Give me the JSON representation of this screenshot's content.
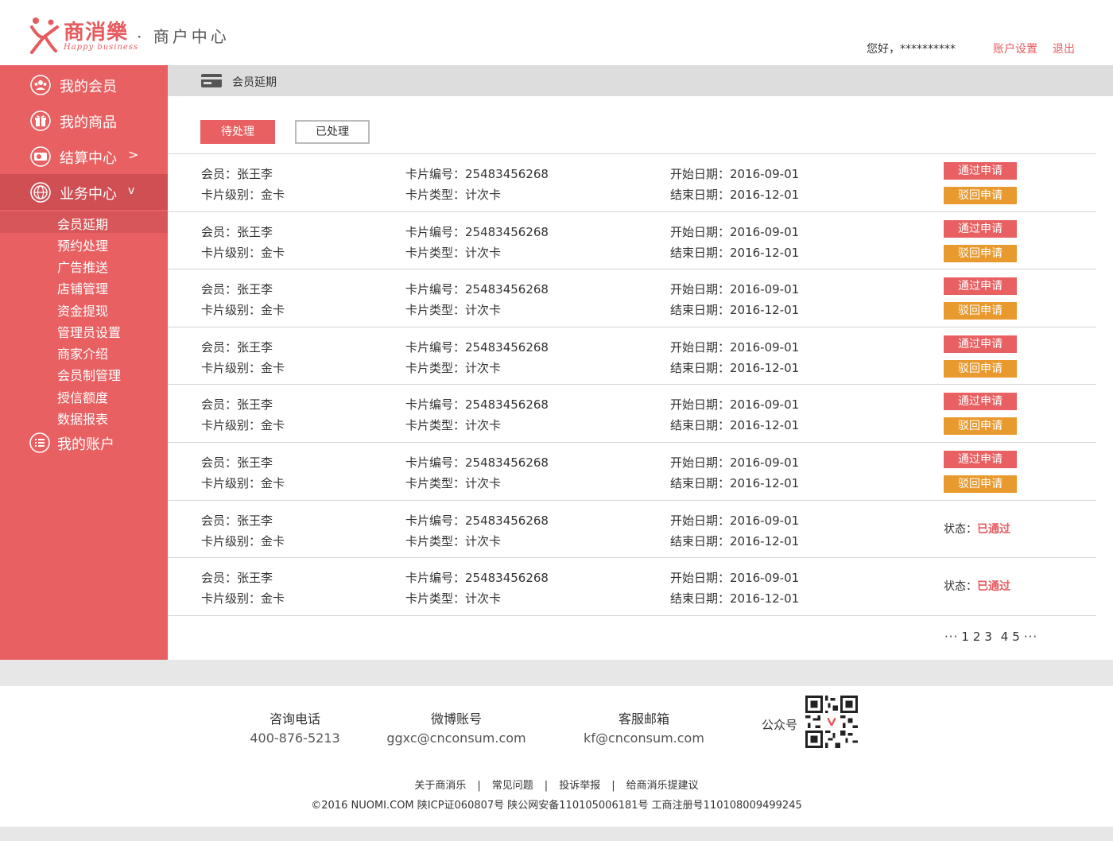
{
  "brand": {
    "logo_cn": "商消樂",
    "logo_en": "Happy business",
    "portal_title": "· 商户中心"
  },
  "header": {
    "greeting": "您好，**********",
    "account_settings": "账户设置",
    "logout": "退出"
  },
  "sidebar": {
    "items": [
      {
        "label": "我的会员",
        "icon": "members-icon"
      },
      {
        "label": "我的商品",
        "icon": "gift-icon"
      },
      {
        "label": "结算中心",
        "arrow": ">",
        "icon": "settlement-icon"
      },
      {
        "label": "业务中心",
        "arrow": "v",
        "icon": "globe-icon"
      }
    ],
    "sub_items": [
      "会员延期",
      "预约处理",
      "广告推送",
      "店铺管理",
      "资金提现",
      "管理员设置",
      "商家介绍",
      "会员制管理",
      "授信额度",
      "数据报表"
    ],
    "account": {
      "label": "我的账户",
      "icon": "list-icon"
    }
  },
  "breadcrumb": {
    "label": "会员延期",
    "icon": "card-icon"
  },
  "tabs": {
    "pending": "待处理",
    "done": "已处理"
  },
  "rows": [
    {
      "member": "会员：张王李",
      "level": "卡片级别：金卡",
      "card_no": "卡片编号：25483456268",
      "card_type": "卡片类型：计次卡",
      "start": "开始日期：2016-09-01",
      "end": "结束日期：2016-12-01",
      "pass": "通过申请",
      "reject": "驳回申请"
    },
    {
      "member": "会员：张王李",
      "level": "卡片级别：金卡",
      "card_no": "卡片编号：25483456268",
      "card_type": "卡片类型：计次卡",
      "start": "开始日期：2016-09-01",
      "end": "结束日期：2016-12-01",
      "pass": "通过申请",
      "reject": "驳回申请"
    },
    {
      "member": "会员：张王李",
      "level": "卡片级别：金卡",
      "card_no": "卡片编号：25483456268",
      "card_type": "卡片类型：计次卡",
      "start": "开始日期：2016-09-01",
      "end": "结束日期：2016-12-01",
      "pass": "通过申请",
      "reject": "驳回申请"
    },
    {
      "member": "会员：张王李",
      "level": "卡片级别：金卡",
      "card_no": "卡片编号：25483456268",
      "card_type": "卡片类型：计次卡",
      "start": "开始日期：2016-09-01",
      "end": "结束日期：2016-12-01",
      "pass": "通过申请",
      "reject": "驳回申请"
    },
    {
      "member": "会员：张王李",
      "level": "卡片级别：金卡",
      "card_no": "卡片编号：25483456268",
      "card_type": "卡片类型：计次卡",
      "start": "开始日期：2016-09-01",
      "end": "结束日期：2016-12-01",
      "pass": "通过申请",
      "reject": "驳回申请"
    },
    {
      "member": "会员：张王李",
      "level": "卡片级别：金卡",
      "card_no": "卡片编号：25483456268",
      "card_type": "卡片类型：计次卡",
      "start": "开始日期：2016-09-01",
      "end": "结束日期：2016-12-01",
      "pass": "通过申请",
      "reject": "驳回申请"
    },
    {
      "member": "会员：张王李",
      "level": "卡片级别：金卡",
      "card_no": "卡片编号：25483456268",
      "card_type": "卡片类型：计次卡",
      "start": "开始日期：2016-09-01",
      "end": "结束日期：2016-12-01",
      "status_label": "状态：",
      "status_value": "已通过"
    },
    {
      "member": "会员：张王李",
      "level": "卡片级别：金卡",
      "card_no": "卡片编号：25483456268",
      "card_type": "卡片类型：计次卡",
      "start": "开始日期：2016-09-01",
      "end": "结束日期：2016-12-01",
      "status_label": "状态：",
      "status_value": "已通过"
    }
  ],
  "pager": {
    "prev": "···",
    "pages": [
      "1",
      "2",
      "3",
      "4",
      "5"
    ],
    "next": "···"
  },
  "footer": {
    "phone": {
      "label": "咨询电话",
      "value": "400-876-5213"
    },
    "weibo": {
      "label": "微博账号",
      "value": "ggxc@cnconsum.com"
    },
    "email": {
      "label": "客服邮箱",
      "value": "kf@cnconsum.com"
    },
    "wechat_label": "公众号",
    "links": [
      "关于商消乐",
      "常见问题",
      "投诉举报",
      "给商消乐提建议"
    ],
    "separator": "|",
    "copyright": "©2016 NUOMI.COM 陕ICP证060807号 陕公网安备110105006181号 工商注册号110108009499245"
  },
  "colors": {
    "accent": "#e86062",
    "accent_dark": "#cf4f53",
    "warning": "#e99a2f"
  }
}
